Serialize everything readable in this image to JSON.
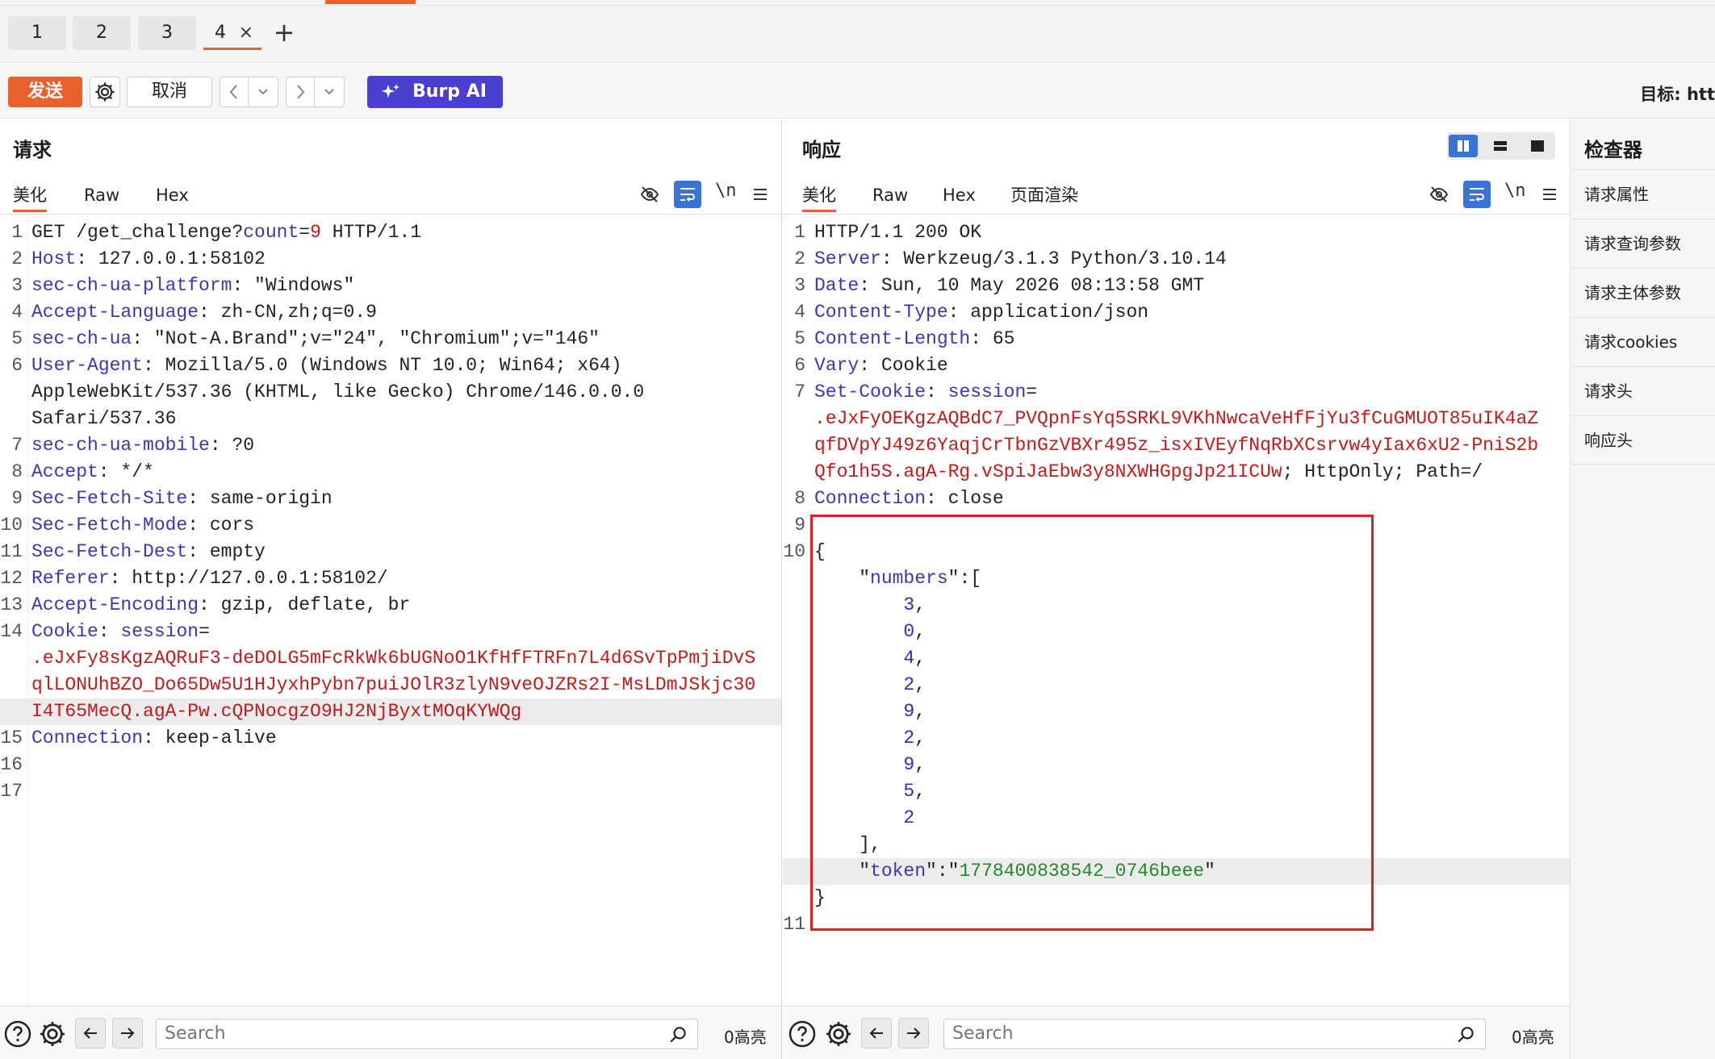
{
  "tabs": [
    {
      "label": "1"
    },
    {
      "label": "2"
    },
    {
      "label": "3"
    },
    {
      "label": "4",
      "active": true
    }
  ],
  "tab_close_glyph": "×",
  "tab_add_glyph": "+",
  "toolbar": {
    "send_label": "发送",
    "cancel_label": "取消",
    "burp_ai_label": "Burp AI",
    "target_label": "目标: htt"
  },
  "request": {
    "title": "请求",
    "subtabs": [
      "美化",
      "Raw",
      "Hex"
    ],
    "newline_toggle": "\\n",
    "lines": [
      {
        "n": "1",
        "segments": [
          {
            "t": "GET /get_challenge?",
            "c": "v"
          },
          {
            "t": "count",
            "c": "k"
          },
          {
            "t": "=",
            "c": "v"
          },
          {
            "t": "9",
            "c": "r"
          },
          {
            "t": " HTTP/1.1",
            "c": "v"
          }
        ]
      },
      {
        "n": "2",
        "segments": [
          {
            "t": "Host",
            "c": "k"
          },
          {
            "t": ": 127.0.0.1:58102",
            "c": "v"
          }
        ]
      },
      {
        "n": "3",
        "segments": [
          {
            "t": "sec-ch-ua-platform",
            "c": "k"
          },
          {
            "t": ": \"Windows\"",
            "c": "v"
          }
        ]
      },
      {
        "n": "4",
        "segments": [
          {
            "t": "Accept-Language",
            "c": "k"
          },
          {
            "t": ": zh-CN,zh;q=0.9",
            "c": "v"
          }
        ]
      },
      {
        "n": "5",
        "segments": [
          {
            "t": "sec-ch-ua",
            "c": "k"
          },
          {
            "t": ": \"Not-A.Brand\";v=\"24\", \"Chromium\";v=\"146\"",
            "c": "v"
          }
        ]
      },
      {
        "n": "6",
        "segments": [
          {
            "t": "User-Agent",
            "c": "k"
          },
          {
            "t": ": Mozilla/5.0 (Windows NT 10.0; Win64; x64)",
            "c": "v"
          }
        ]
      },
      {
        "n": "",
        "segments": [
          {
            "t": "AppleWebKit/537.36 (KHTML, like Gecko) Chrome/146.0.0.0",
            "c": "v"
          }
        ]
      },
      {
        "n": "",
        "segments": [
          {
            "t": "Safari/537.36",
            "c": "v"
          }
        ]
      },
      {
        "n": "7",
        "segments": [
          {
            "t": "sec-ch-ua-mobile",
            "c": "k"
          },
          {
            "t": ": ?0",
            "c": "v"
          }
        ]
      },
      {
        "n": "8",
        "segments": [
          {
            "t": "Accept",
            "c": "k"
          },
          {
            "t": ": */*",
            "c": "v"
          }
        ]
      },
      {
        "n": "9",
        "segments": [
          {
            "t": "Sec-Fetch-Site",
            "c": "k"
          },
          {
            "t": ": same-origin",
            "c": "v"
          }
        ]
      },
      {
        "n": "10",
        "segments": [
          {
            "t": "Sec-Fetch-Mode",
            "c": "k"
          },
          {
            "t": ": cors",
            "c": "v"
          }
        ]
      },
      {
        "n": "11",
        "segments": [
          {
            "t": "Sec-Fetch-Dest",
            "c": "k"
          },
          {
            "t": ": empty",
            "c": "v"
          }
        ]
      },
      {
        "n": "12",
        "segments": [
          {
            "t": "Referer",
            "c": "k"
          },
          {
            "t": ": http://127.0.0.1:58102/",
            "c": "v"
          }
        ]
      },
      {
        "n": "13",
        "segments": [
          {
            "t": "Accept-Encoding",
            "c": "k"
          },
          {
            "t": ": gzip, deflate, br",
            "c": "v"
          }
        ]
      },
      {
        "n": "14",
        "segments": [
          {
            "t": "Cookie",
            "c": "k"
          },
          {
            "t": ": ",
            "c": "v"
          },
          {
            "t": "session",
            "c": "k"
          },
          {
            "t": "=",
            "c": "v"
          }
        ]
      },
      {
        "n": "",
        "segments": [
          {
            "t": ".eJxFy8sKgzAQRuF3-deDOLG5mFcRkWk6bUGNoO1KfHfFTRFn7L4d6SvTpPmjiDvS",
            "c": "r"
          }
        ]
      },
      {
        "n": "",
        "segments": [
          {
            "t": "qlLONUhBZO_Do65Dw5U1HJyxhPybn7puiJOlR3zlyN9veOJZRs2I-MsLDmJSkjc30",
            "c": "r"
          }
        ]
      },
      {
        "n": "",
        "hl": true,
        "segments": [
          {
            "t": "I4T65MecQ.agA-Pw.cQPNocgzO9HJ2NjByxtMOqKYWQg",
            "c": "r"
          }
        ]
      },
      {
        "n": "15",
        "segments": [
          {
            "t": "Connection",
            "c": "k"
          },
          {
            "t": ": keep-alive",
            "c": "v"
          }
        ]
      },
      {
        "n": "16",
        "segments": []
      },
      {
        "n": "17",
        "segments": []
      }
    ],
    "search_placeholder": "Search",
    "highlight_count": "0高亮"
  },
  "response": {
    "title": "响应",
    "subtabs": [
      "美化",
      "Raw",
      "Hex",
      "页面渲染"
    ],
    "newline_toggle": "\\n",
    "lines": [
      {
        "n": "1",
        "segments": [
          {
            "t": "HTTP/1.1 200 OK",
            "c": "v"
          }
        ]
      },
      {
        "n": "2",
        "segments": [
          {
            "t": "Server",
            "c": "k"
          },
          {
            "t": ": Werkzeug/3.1.3 Python/3.10.14",
            "c": "v"
          }
        ]
      },
      {
        "n": "3",
        "segments": [
          {
            "t": "Date",
            "c": "k"
          },
          {
            "t": ": Sun, 10 May 2026 08:13:58 GMT",
            "c": "v"
          }
        ]
      },
      {
        "n": "4",
        "segments": [
          {
            "t": "Content-Type",
            "c": "k"
          },
          {
            "t": ": application/json",
            "c": "v"
          }
        ]
      },
      {
        "n": "5",
        "segments": [
          {
            "t": "Content-Length",
            "c": "k"
          },
          {
            "t": ": 65",
            "c": "v"
          }
        ]
      },
      {
        "n": "6",
        "segments": [
          {
            "t": "Vary",
            "c": "k"
          },
          {
            "t": ": Cookie",
            "c": "v"
          }
        ]
      },
      {
        "n": "7",
        "segments": [
          {
            "t": "Set-Cookie",
            "c": "k"
          },
          {
            "t": ": ",
            "c": "v"
          },
          {
            "t": "session",
            "c": "k"
          },
          {
            "t": "=",
            "c": "v"
          }
        ]
      },
      {
        "n": "",
        "segments": [
          {
            "t": ".eJxFyOEKgzAQBdC7_PVQpnFsYq5SRKL9VKhNwcaVeHfFjYu3fCuGMUOT85uIK4aZ",
            "c": "r"
          }
        ]
      },
      {
        "n": "",
        "segments": [
          {
            "t": "qfDVpYJ49z6YaqjCrTbnGzVBXr495z_isxIVEyfNqRbXCsrvw4yIax6xU2-PniS2b",
            "c": "r"
          }
        ]
      },
      {
        "n": "",
        "segments": [
          {
            "t": "Qfo1h5S.agA-Rg.vSpiJaEbw3y8NXWHGpgJp21ICUw",
            "c": "r"
          },
          {
            "t": "; HttpOnly; Path=/",
            "c": "v"
          }
        ]
      },
      {
        "n": "8",
        "segments": [
          {
            "t": "Connection",
            "c": "k"
          },
          {
            "t": ": close",
            "c": "v"
          }
        ]
      },
      {
        "n": "9",
        "segments": []
      },
      {
        "n": "10",
        "segments": [
          {
            "t": "{",
            "c": "v"
          }
        ]
      },
      {
        "n": "",
        "segments": [
          {
            "t": "    \"",
            "c": "v"
          },
          {
            "t": "numbers",
            "c": "k"
          },
          {
            "t": "\":[",
            "c": "v"
          }
        ]
      },
      {
        "n": "",
        "segments": [
          {
            "t": "        ",
            "c": "v"
          },
          {
            "t": "3",
            "c": "num"
          },
          {
            "t": ",",
            "c": "v"
          }
        ]
      },
      {
        "n": "",
        "segments": [
          {
            "t": "        ",
            "c": "v"
          },
          {
            "t": "0",
            "c": "num"
          },
          {
            "t": ",",
            "c": "v"
          }
        ]
      },
      {
        "n": "",
        "segments": [
          {
            "t": "        ",
            "c": "v"
          },
          {
            "t": "4",
            "c": "num"
          },
          {
            "t": ",",
            "c": "v"
          }
        ]
      },
      {
        "n": "",
        "segments": [
          {
            "t": "        ",
            "c": "v"
          },
          {
            "t": "2",
            "c": "num"
          },
          {
            "t": ",",
            "c": "v"
          }
        ]
      },
      {
        "n": "",
        "segments": [
          {
            "t": "        ",
            "c": "v"
          },
          {
            "t": "9",
            "c": "num"
          },
          {
            "t": ",",
            "c": "v"
          }
        ]
      },
      {
        "n": "",
        "segments": [
          {
            "t": "        ",
            "c": "v"
          },
          {
            "t": "2",
            "c": "num"
          },
          {
            "t": ",",
            "c": "v"
          }
        ]
      },
      {
        "n": "",
        "segments": [
          {
            "t": "        ",
            "c": "v"
          },
          {
            "t": "9",
            "c": "num"
          },
          {
            "t": ",",
            "c": "v"
          }
        ]
      },
      {
        "n": "",
        "segments": [
          {
            "t": "        ",
            "c": "v"
          },
          {
            "t": "5",
            "c": "num"
          },
          {
            "t": ",",
            "c": "v"
          }
        ]
      },
      {
        "n": "",
        "segments": [
          {
            "t": "        ",
            "c": "v"
          },
          {
            "t": "2",
            "c": "num"
          }
        ]
      },
      {
        "n": "",
        "segments": [
          {
            "t": "    ],",
            "c": "v"
          }
        ]
      },
      {
        "n": "",
        "hl": true,
        "segments": [
          {
            "t": "    \"",
            "c": "v"
          },
          {
            "t": "token",
            "c": "k"
          },
          {
            "t": "\":\"",
            "c": "v"
          },
          {
            "t": "1778400838542_0746beee",
            "c": "g"
          },
          {
            "t": "\"",
            "c": "v"
          }
        ]
      },
      {
        "n": "",
        "segments": [
          {
            "t": "}",
            "c": "v"
          }
        ]
      },
      {
        "n": "11",
        "segments": []
      }
    ],
    "search_placeholder": "Search",
    "highlight_count": "0高亮"
  },
  "inspector": {
    "title": "检查器",
    "items": [
      "请求属性",
      "请求查询参数",
      "请求主体参数",
      "请求cookies",
      "请求头",
      "响应头"
    ]
  },
  "colors": {
    "accent": "#e8612c",
    "burp_ai": "#4b3fd1",
    "selected_icon": "#3a73d8",
    "annotation_box": "#e02020"
  }
}
